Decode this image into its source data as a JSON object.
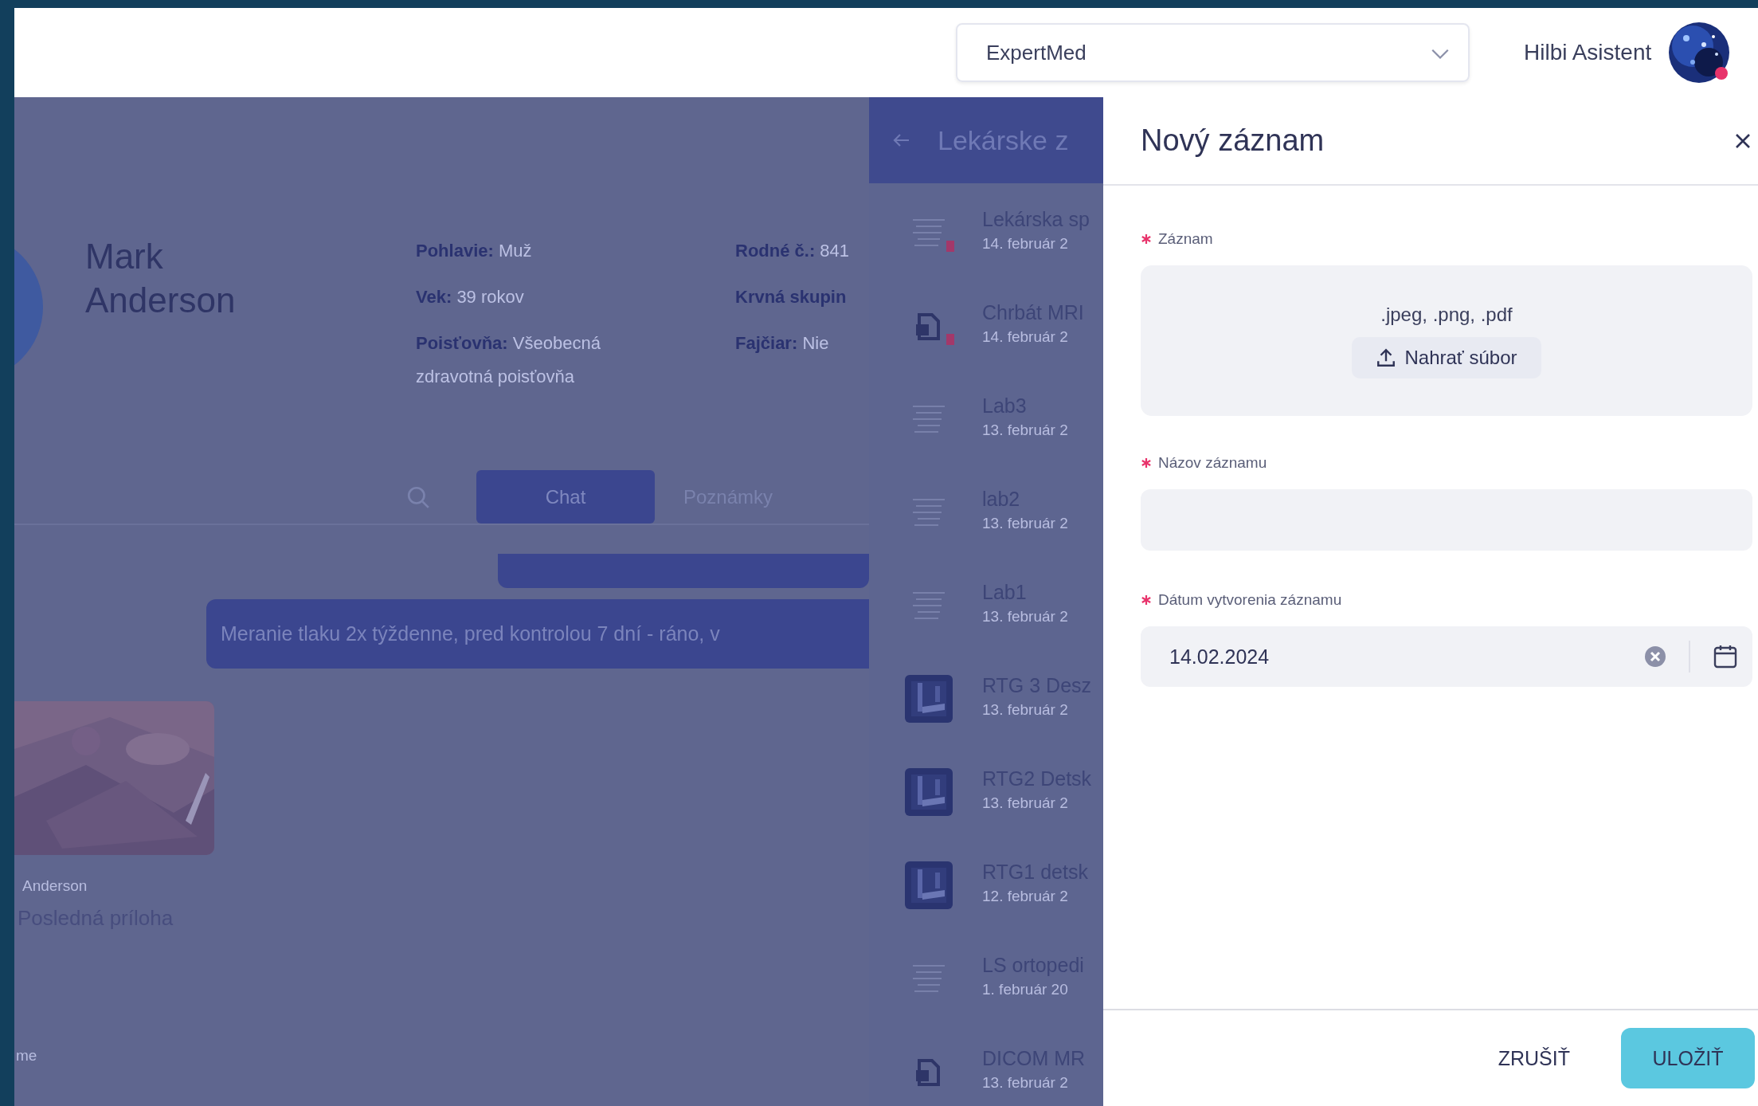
{
  "topbar": {
    "clinic_select": {
      "value": "ExpertMed"
    },
    "user_name": "Hilbi Asistent"
  },
  "patient": {
    "name": "Mark Anderson",
    "details": [
      {
        "label": "Pohlavie:",
        "value": "Muž"
      },
      {
        "label": "Vek:",
        "value": "39 rokov"
      },
      {
        "label": "Poisťovňa:",
        "value": "Všeobecná zdravotná poisťovňa"
      }
    ],
    "details_2": [
      {
        "label": "Rodné č.:",
        "value": "841"
      },
      {
        "label": "Krvná skupin"
      },
      {
        "label": "Fajčiar:",
        "value": "Nie"
      }
    ]
  },
  "tabs": [
    {
      "label": "Chat",
      "selected": true
    },
    {
      "label": "Poznámky",
      "selected": false
    }
  ],
  "chat": {
    "message": "Meranie tlaku 2x týždenne, pred kontrolou 7 dní - ráno, v"
  },
  "attachment": {
    "kind": "picture",
    "author": "Anderson",
    "caption": "Posledná príloha"
  },
  "footer_fragment": "me",
  "records_panel": {
    "title": "Lekárske z",
    "items": [
      {
        "title": "Lekárska sp",
        "date": "14. február 2",
        "kind": "document",
        "flagged": true
      },
      {
        "title": "Chrbát MRI",
        "date": "14. február 2",
        "kind": "file",
        "flagged": true
      },
      {
        "title": "Lab3",
        "date": "13. február 2",
        "kind": "document",
        "flagged": false
      },
      {
        "title": "lab2",
        "date": "13. február 2",
        "kind": "document",
        "flagged": false
      },
      {
        "title": "Lab1",
        "date": "13. február 2",
        "kind": "document",
        "flagged": false
      },
      {
        "title": "RTG 3 Desz",
        "date": "13. február 2",
        "kind": "xray",
        "flagged": false
      },
      {
        "title": "RTG2 Detsk",
        "date": "13. február 2",
        "kind": "xray",
        "flagged": false
      },
      {
        "title": "RTG1 detsk",
        "date": "12. február 2",
        "kind": "xray",
        "flagged": false
      },
      {
        "title": "LS ortopedi",
        "date": "1. február 20",
        "kind": "document",
        "flagged": false
      },
      {
        "title": "DICOM MR",
        "date": "13. február 2",
        "kind": "file",
        "flagged": false
      }
    ]
  },
  "drawer": {
    "title": "Nový záznam",
    "fields": [
      {
        "kind": "upload",
        "label": "Záznam",
        "required": true,
        "formats": ".jpeg, .png, .pdf",
        "button": "Nahrať súbor"
      },
      {
        "kind": "text",
        "label": "Názov záznamu",
        "required": true
      },
      {
        "kind": "date",
        "label": "Dátum vytvorenia záznamu",
        "required": true,
        "value": "14.02.2024"
      }
    ],
    "actions": [
      {
        "label": "ZRUŠIŤ",
        "kind": "text"
      },
      {
        "label": "ULOŽIŤ",
        "kind": "primary"
      }
    ]
  }
}
